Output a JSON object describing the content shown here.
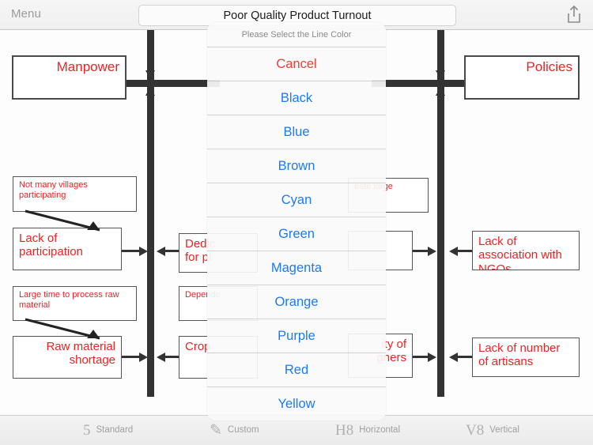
{
  "navbar": {
    "menu_label": "Menu",
    "title": "Poor Quality Product Turnout",
    "share_icon": "share-icon"
  },
  "sheet": {
    "title": "Please Select the Line Color",
    "options": [
      {
        "label": "Cancel",
        "role": "cancel"
      },
      {
        "label": "Black",
        "role": "default"
      },
      {
        "label": "Blue",
        "role": "default"
      },
      {
        "label": "Brown",
        "role": "default"
      },
      {
        "label": "Cyan",
        "role": "default"
      },
      {
        "label": "Green",
        "role": "default"
      },
      {
        "label": "Magenta",
        "role": "default"
      },
      {
        "label": "Orange",
        "role": "default"
      },
      {
        "label": "Purple",
        "role": "default"
      },
      {
        "label": "Red",
        "role": "default"
      },
      {
        "label": "Yellow",
        "role": "default"
      }
    ]
  },
  "diagram": {
    "heads": {
      "left": "Manpower",
      "right": "Policies"
    },
    "boxes": {
      "l1_note": "Not many villages participating",
      "l1_main": "Lack of participation",
      "l2_note": "Large time to process raw material",
      "l2_main": "Raw material shortage",
      "m1_main": "Dedic",
      "m1_sub": "for pl",
      "m2_note": "Depende",
      "m2_main": "Crop",
      "r_note_partial": "eate large",
      "r_main_partial_1": "ity of",
      "r_main_partial_2": "gners",
      "r1": "Lack of association with NGOs",
      "r2": "Lack of number of artisans"
    }
  },
  "toolbar": {
    "items": [
      {
        "label": "Standard",
        "glyph": "5",
        "icon": "standard-icon"
      },
      {
        "label": "Custom",
        "glyph": "✎",
        "icon": "pencil-icon"
      },
      {
        "label": "Horizontal",
        "glyph": "H8",
        "icon": "horizontal-icon"
      },
      {
        "label": "Vertical",
        "glyph": "V8",
        "icon": "vertical-icon"
      }
    ]
  },
  "colors": {
    "accent_blue": "#1a7bf2",
    "cancel_red": "#f43a30",
    "box_text_red": "#ee2222",
    "spine": "#333333"
  }
}
